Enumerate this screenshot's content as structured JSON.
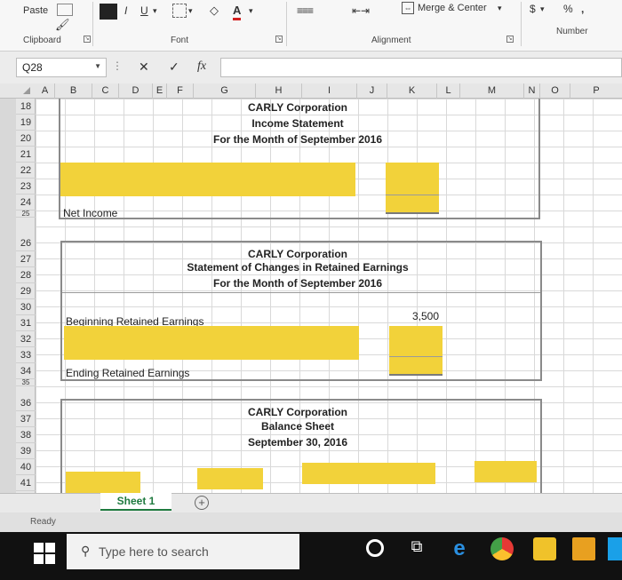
{
  "ribbon": {
    "paste_label": "Paste",
    "clipboard_label": "Clipboard",
    "font_label": "Font",
    "alignment_label": "Alignment",
    "number_label": "Number",
    "merge_center_label": "Merge & Center",
    "italic_label": "I",
    "underline_label": "U",
    "font_color_label": "A",
    "currency_label": "$",
    "percent_label": "%"
  },
  "formula_bar": {
    "name_box": "Q28",
    "fx_label": "fx",
    "cancel_label": "✕",
    "enter_label": "✓"
  },
  "columns": [
    "A",
    "B",
    "C",
    "D",
    "E",
    "F",
    "G",
    "H",
    "I",
    "J",
    "K",
    "L",
    "M",
    "N",
    "O",
    "P"
  ],
  "rows": [
    "18",
    "19",
    "20",
    "21",
    "22",
    "23",
    "24",
    "25",
    "26",
    "27",
    "28",
    "29",
    "30",
    "31",
    "32",
    "33",
    "34",
    "35",
    "36",
    "37",
    "38",
    "39",
    "40",
    "41"
  ],
  "income_statement": {
    "company": "CARLY Corporation",
    "title": "Income Statement",
    "period": "For the Month of September 2016",
    "net_income_label": "Net Income"
  },
  "retained_earnings": {
    "company": "CARLY Corporation",
    "title": "Statement of Changes in Retained Earnings",
    "period": "For the Month of September 2016",
    "beginning_label": "Beginning Retained Earnings",
    "beginning_value": "3,500",
    "ending_label": "Ending Retained Earnings"
  },
  "balance_sheet": {
    "company": "CARLY Corporation",
    "title": "Balance Sheet",
    "date": "September 30, 2016"
  },
  "sheet_tabs": {
    "sheet1": "Sheet 1",
    "add_sheet": "+"
  },
  "status": {
    "text": "Ready"
  },
  "taskbar": {
    "search_placeholder": "Type here to search"
  },
  "colors": {
    "highlight": "#f2d23a",
    "excel_green": "#1f7a3f"
  }
}
